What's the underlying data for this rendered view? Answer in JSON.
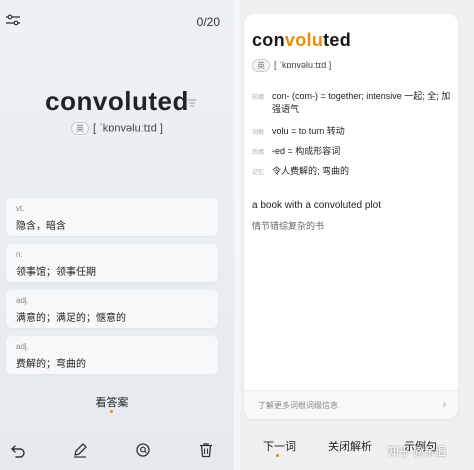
{
  "left": {
    "progress": "0/20",
    "word": "convoluted",
    "accent_tag": "英",
    "phonetic": "[ ˈkɒnvəluːtɪd ]",
    "cards": [
      {
        "pos": "vt.",
        "def": "隐含，暗含"
      },
      {
        "pos": "n.",
        "def": "领事馆；领事任期"
      },
      {
        "pos": "adj.",
        "def": "满意的；满足的；惬意的"
      },
      {
        "pos": "adj.",
        "def": "费解的；弯曲的"
      }
    ],
    "answer_label": "看答案",
    "icons": [
      "settings-icon",
      "back-icon",
      "edit-icon",
      "search-icon",
      "delete-icon"
    ]
  },
  "right": {
    "word_prefix": "con",
    "word_root": "volu",
    "word_suffix": "ted",
    "accent_tag": "英",
    "phonetic": "[ ˈkɒnvəluːtɪd ]",
    "rows": [
      {
        "label": "前缀",
        "text": "con- (com-) = together; intensive  一起; 全; 加强语气"
      },
      {
        "label": "词根",
        "text": "volu = to turn  转动"
      },
      {
        "label": "后缀",
        "text": "-ed = 构成形容词"
      },
      {
        "label": "记忆",
        "text": "令人费解的; 弯曲的"
      }
    ],
    "example_en": "a book with a convoluted plot",
    "example_cn": "情节错综复杂的书",
    "more_text": "了解更多词根词缀信息",
    "buttons": {
      "next": "下一词",
      "close": "关闭解析",
      "example": "示例句"
    },
    "watermark": "知乎 @余温"
  },
  "colors": {
    "accent": "#f08a00"
  }
}
